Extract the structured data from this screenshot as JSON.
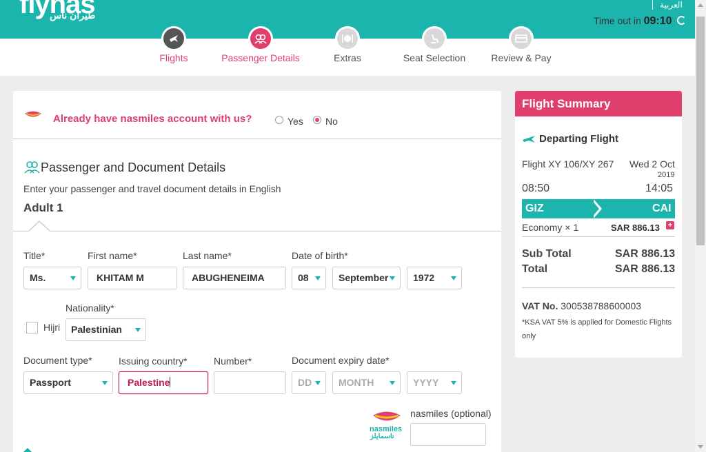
{
  "header": {
    "logo": "flynas",
    "logo_arabic": "طيران ناس",
    "language_link": "العربية",
    "timeout_label": "Time out in",
    "timeout_value": "09:10"
  },
  "steps": [
    {
      "label": "Flights",
      "icon": "plane-icon",
      "state": "done"
    },
    {
      "label": "Passenger Details",
      "icon": "passengers-icon",
      "state": "active"
    },
    {
      "label": "Extras",
      "icon": "plate-icon",
      "state": "todo"
    },
    {
      "label": "Seat Selection",
      "icon": "seat-icon",
      "state": "todo"
    },
    {
      "label": "Review & Pay",
      "icon": "card-icon",
      "state": "todo"
    }
  ],
  "nasmiles_question": {
    "text": "Already have nasmiles account with us?",
    "yes_label": "Yes",
    "no_label": "No",
    "selected": "No"
  },
  "passenger_section": {
    "title": "Passenger and Document Details",
    "subtitle": "Enter your passenger and travel document details in English",
    "adult_label": "Adult 1"
  },
  "form": {
    "title_label": "Title*",
    "title_value": "Ms.",
    "first_name_label": "First name*",
    "first_name_value": "KHITAM M",
    "last_name_label": "Last name*",
    "last_name_value": "ABUGHENEIMA",
    "dob_label": "Date of birth*",
    "dob_day": "08",
    "dob_month": "September",
    "dob_year": "1972",
    "hijri_label": "Hijri",
    "nationality_label": "Nationality*",
    "nationality_value": "Palestinian",
    "doc_type_label": "Document type*",
    "doc_type_value": "Passport",
    "issuing_country_label": "Issuing country*",
    "issuing_country_value": "Palestine",
    "number_label": "Number*",
    "number_value": "",
    "expiry_label": "Document expiry date*",
    "expiry_day_placeholder": "DD",
    "expiry_month_placeholder": "MONTH",
    "expiry_year_placeholder": "YYYY",
    "nasmiles_optional_label": "nasmiles (optional)",
    "nasmiles_logo_text": "nasmiles",
    "nasmiles_logo_arabic": "ناسمايلز"
  },
  "summary": {
    "title": "Flight Summary",
    "departing_label": "Departing Flight",
    "flight_number": "Flight XY 106/XY 267",
    "date_line": "Wed 2 Oct",
    "year": "2019",
    "depart_time": "08:50",
    "arrive_time": "14:05",
    "from": "GIZ",
    "to": "CAI",
    "fare_label": "Economy × 1",
    "fare_price": "SAR 886.13",
    "subtotal_label": "Sub Total",
    "subtotal_value": "SAR 886.13",
    "total_label": "Total",
    "total_value": "SAR 886.13",
    "vat_label": "VAT No.",
    "vat_number": "300538788600003",
    "vat_note": "*KSA VAT 5% is applied for Domestic Flights only"
  },
  "colors": {
    "brand_teal": "#1cb5ad",
    "brand_pink": "#e03f6e",
    "background": "#ededed"
  }
}
